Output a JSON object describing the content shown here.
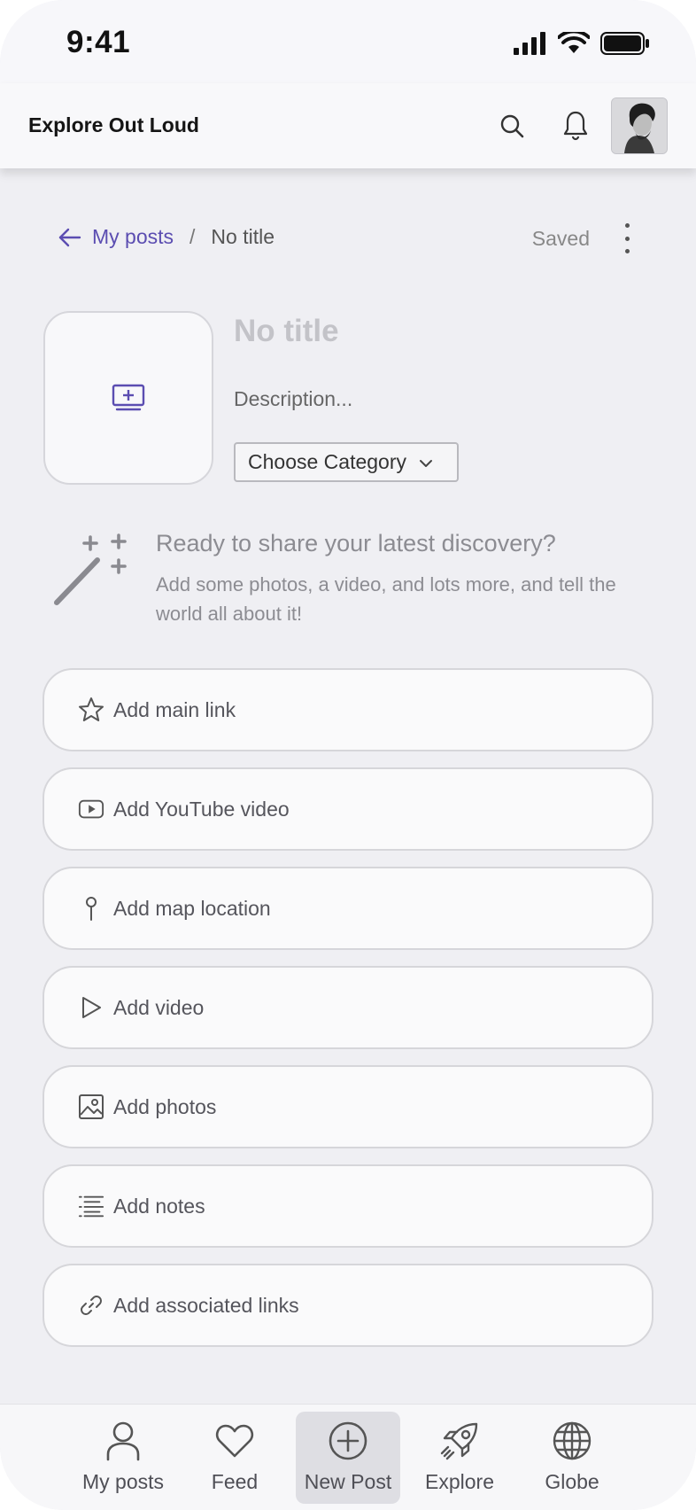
{
  "status_bar": {
    "time": "9:41"
  },
  "header": {
    "app_title": "Explore Out Loud",
    "icons": [
      "search-icon",
      "bell-icon",
      "avatar"
    ]
  },
  "breadcrumb": {
    "back_label": "My posts",
    "separator": "/",
    "current": "No title",
    "status": "Saved"
  },
  "post": {
    "title_placeholder": "No title",
    "description_placeholder": "Description...",
    "category_label": "Choose Category"
  },
  "prompt": {
    "heading": "Ready to share your latest discovery?",
    "text": "Add some photos, a video, and lots more, and tell the world all about it!"
  },
  "actions": [
    {
      "label": "Add main link",
      "icon": "star-icon"
    },
    {
      "label": "Add YouTube video",
      "icon": "youtube-icon"
    },
    {
      "label": "Add map location",
      "icon": "map-pin-icon"
    },
    {
      "label": "Add video",
      "icon": "play-icon"
    },
    {
      "label": "Add photos",
      "icon": "image-icon"
    },
    {
      "label": "Add notes",
      "icon": "notes-icon"
    },
    {
      "label": "Add associated links",
      "icon": "link-icon"
    }
  ],
  "tabs": [
    {
      "label": "My posts",
      "icon": "person-icon",
      "active": false
    },
    {
      "label": "Feed",
      "icon": "heart-icon",
      "active": false
    },
    {
      "label": "New Post",
      "icon": "plus-circle-icon",
      "active": true
    },
    {
      "label": "Explore",
      "icon": "rocket-icon",
      "active": false
    },
    {
      "label": "Globe",
      "icon": "globe-icon",
      "active": false
    }
  ],
  "colors": {
    "accent": "#5b4db1",
    "background": "#efeff3",
    "card": "#fafafb"
  }
}
